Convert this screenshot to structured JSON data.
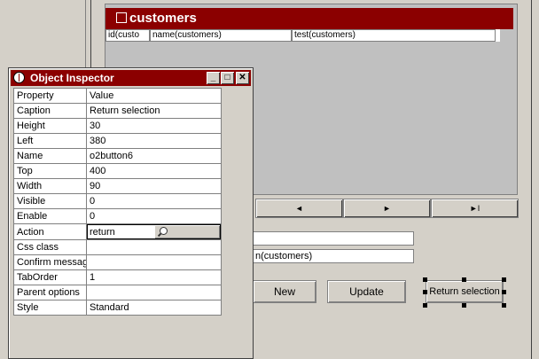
{
  "grid": {
    "title": "customers",
    "columns": [
      "id(custo",
      "name(customers)",
      "test(customers)"
    ]
  },
  "nav": {
    "prev_glyph": "◄",
    "next_glyph": "►",
    "last_glyph": "►I"
  },
  "fields": {
    "field1_value": "",
    "field2_value": "n(customers)"
  },
  "buttons": {
    "new_label": "New",
    "update_label": "Update",
    "return_label": "Return selection"
  },
  "inspector": {
    "title": "Object Inspector",
    "window_buttons": {
      "minimize": "_",
      "maximize": "□",
      "close": "✕"
    },
    "header": {
      "property": "Property",
      "value": "Value"
    },
    "rows": [
      {
        "property": "Caption",
        "value": "Return selection"
      },
      {
        "property": "Height",
        "value": "30"
      },
      {
        "property": "Left",
        "value": "380"
      },
      {
        "property": "Name",
        "value": "o2button6"
      },
      {
        "property": "Top",
        "value": "400"
      },
      {
        "property": "Width",
        "value": "90"
      },
      {
        "property": "Visible",
        "value": "0"
      },
      {
        "property": "Enable",
        "value": "0"
      },
      {
        "property": "Action",
        "value": "return"
      },
      {
        "property": "Css class",
        "value": ""
      },
      {
        "property": "Confirm message",
        "value": ""
      },
      {
        "property": "TabOrder",
        "value": "1"
      },
      {
        "property": "Parent options",
        "value": ""
      },
      {
        "property": "Style",
        "value": "Standard"
      }
    ]
  },
  "colors": {
    "titlebar": "#8b0000",
    "window": "#d4d0c8"
  }
}
